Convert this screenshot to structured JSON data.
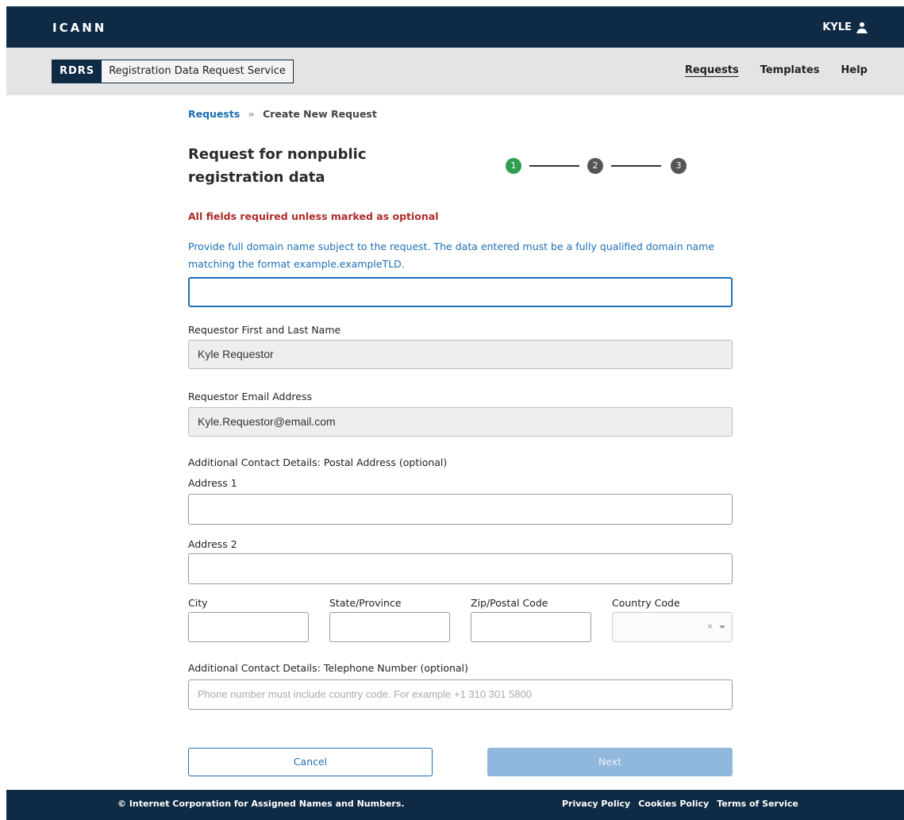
{
  "header": {
    "logo": "ICANN",
    "user_name": "KYLE"
  },
  "subnav": {
    "brand_tag": "RDRS",
    "brand_name": "Registration Data Request Service",
    "links": [
      "Requests",
      "Templates",
      "Help"
    ]
  },
  "breadcrumb": {
    "root": "Requests",
    "separator": "»",
    "current": "Create New Request"
  },
  "page_title": "Request for nonpublic registration data",
  "stepper": {
    "steps": [
      "1",
      "2",
      "3"
    ],
    "current_step": 1
  },
  "form": {
    "required_note": "All fields required unless marked as optional",
    "domain_instruction": "Provide full domain name subject to the request. The data entered must be a fully qualified domain name matching the format example.exampleTLD.",
    "domain_value": "",
    "name_label": "Requestor First and Last Name",
    "name_value": "Kyle Requestor",
    "email_label": "Requestor Email Address",
    "email_value": "Kyle.Requestor@email.com",
    "postal_section_label": "Additional Contact Details: Postal Address (optional)",
    "address1_label": "Address 1",
    "address2_label": "Address 2",
    "city_label": "City",
    "state_label": "State/Province",
    "zip_label": "Zip/Postal Code",
    "country_label": "Country Code",
    "phone_section_label": "Additional Contact Details: Telephone Number (optional)",
    "phone_placeholder": "Phone number must include country code. For example +1 310 301 5800",
    "clear_glyph": "×"
  },
  "actions": {
    "cancel_label": "Cancel",
    "next_label": "Next"
  },
  "footer": {
    "copyright": "© Internet Corporation for Assigned Names and Numbers.",
    "links": [
      "Privacy Policy",
      "Cookies Policy",
      "Terms of Service"
    ]
  },
  "colors": {
    "navy": "#0f2a44",
    "link_blue": "#1d6fb5",
    "error_red": "#b02a2a",
    "step_active": "#2f9e4f",
    "button_disabled": "#8fb8dc"
  }
}
